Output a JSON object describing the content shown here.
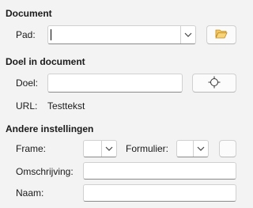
{
  "sections": {
    "document": {
      "title": "Document",
      "path_label": "Pad:",
      "path_value": ""
    },
    "target": {
      "title": "Doel in document",
      "target_label": "Doel:",
      "target_value": "",
      "url_label": "URL:",
      "url_value": "Testtekst"
    },
    "other": {
      "title": "Andere instellingen",
      "frame_label": "Frame:",
      "frame_value": "",
      "form_label": "Formulier:",
      "form_value": "",
      "description_label": "Omschrijving:",
      "description_value": "",
      "name_label": "Naam:",
      "name_value": ""
    }
  },
  "icons": {
    "folder": "folder-open-icon",
    "target": "crosshair-target-icon",
    "dropdown": "chevron-down-icon"
  },
  "colors": {
    "background": "#f3f3f3",
    "folder": "#e8b54a",
    "field_border": "#d0d0d0",
    "field_bottom_border": "#8a8a8a"
  }
}
